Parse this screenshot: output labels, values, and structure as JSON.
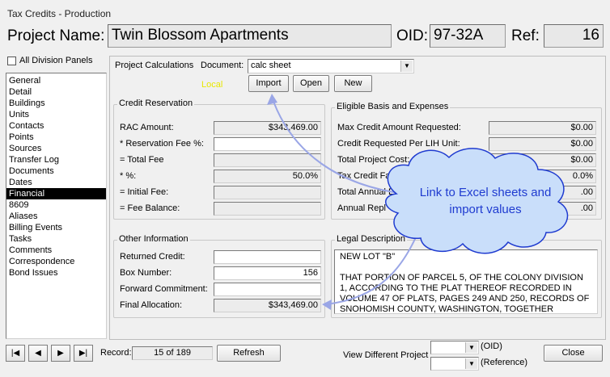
{
  "window": {
    "title": "Tax Credits - Production"
  },
  "header": {
    "project_name_label": "Project Name:",
    "project_name": "Twin Blossom Apartments",
    "oid_label": "OID:",
    "oid": "97-32A",
    "ref_label": "Ref:",
    "ref": "16"
  },
  "sidebar": {
    "all_division_label": "All Division Panels",
    "items": [
      {
        "label": "General"
      },
      {
        "label": "Detail"
      },
      {
        "label": "Buildings"
      },
      {
        "label": "Units"
      },
      {
        "label": "Contacts"
      },
      {
        "label": "Points"
      },
      {
        "label": "Sources"
      },
      {
        "label": "Transfer Log"
      },
      {
        "label": "Documents"
      },
      {
        "label": "Dates"
      },
      {
        "label": "Financial"
      },
      {
        "label": "8609"
      },
      {
        "label": "Aliases"
      },
      {
        "label": "Billing Events"
      },
      {
        "label": "Tasks"
      },
      {
        "label": "Comments"
      },
      {
        "label": "Correspondence"
      },
      {
        "label": "Bond Issues"
      }
    ],
    "selected": "Financial"
  },
  "calc": {
    "section_label": "Project Calculations",
    "document_label": "Document:",
    "document_value": "calc sheet",
    "local_label": "Local",
    "import_label": "Import",
    "open_label": "Open",
    "new_label": "New"
  },
  "credit_reservation": {
    "title": "Credit Reservation",
    "rows": [
      {
        "label": "RAC Amount:",
        "value": "$343,469.00"
      },
      {
        "label": "* Reservation Fee %:",
        "value": ""
      },
      {
        "label": "= Total Fee",
        "value": ""
      },
      {
        "label": "* %:",
        "value": "50.0%"
      },
      {
        "label": "= Initial Fee:",
        "value": ""
      },
      {
        "label": "= Fee Balance:",
        "value": ""
      }
    ]
  },
  "eligible_basis": {
    "title": "Eligible Basis and Expenses",
    "rows": [
      {
        "label": "Max Credit Amount Requested:",
        "value": "$0.00"
      },
      {
        "label": "Credit Requested Per LIH Unit:",
        "value": "$0.00"
      },
      {
        "label": "Total Project Cost:",
        "value": "$0.00"
      },
      {
        "label": "Tax Credit Fact",
        "value": "0.0%"
      },
      {
        "label": "Total Annual E",
        "value": ".00"
      },
      {
        "label": "Annual Repl",
        "value": ".00"
      }
    ]
  },
  "other_info": {
    "title": "Other Information",
    "rows": [
      {
        "label": "Returned Credit:",
        "value": ""
      },
      {
        "label": "Box Number:",
        "value": "156"
      },
      {
        "label": "Forward Commitment:",
        "value": ""
      },
      {
        "label": "Final Allocation:",
        "value": "$343,469.00"
      }
    ]
  },
  "legal": {
    "title": "Legal Description",
    "text": "NEW LOT \"B\"\n\nTHAT PORTION OF PARCEL 5, OF THE COLONY DIVISION 1, ACCORDING TO THE PLAT THEREOF RECORDED IN VOLUME 47 OF PLATS, PAGES 249 AND 250, RECORDS OF SNOHOMISH COUNTY, WASHINGTON, TOGETHER"
  },
  "callout": {
    "text": "Link to Excel sheets and import values"
  },
  "footer": {
    "record_label": "Record:",
    "record_value": "15 of 189",
    "refresh_label": "Refresh",
    "view_different_label": "View Different Project",
    "oid_hint": "(OID)",
    "reference_hint": "(Reference)",
    "close_label": "Close"
  },
  "colors": {
    "callout_fill": "#c9defa",
    "callout_text": "#1f3bd0",
    "local_text": "#e8e800"
  }
}
